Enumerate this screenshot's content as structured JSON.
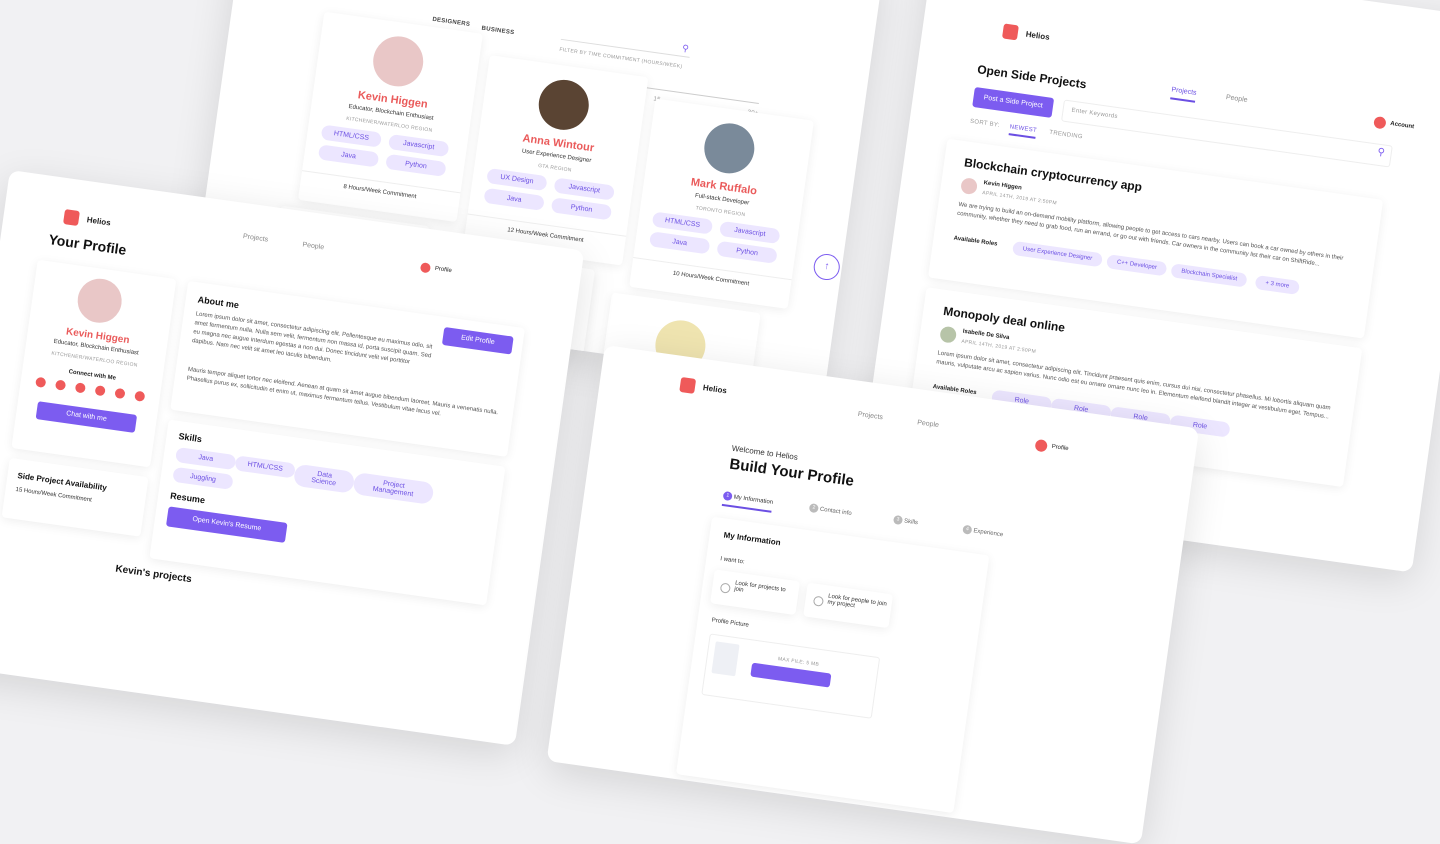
{
  "brand": {
    "name": "Helios"
  },
  "talent": {
    "filters": {
      "tab_designers": "DESIGNERS",
      "tab_business": "BUSINESS",
      "label": "FILTER BY TIME COMMITMENT (HOURS/WEEK)",
      "tick_0": "0",
      "tick_15": "15",
      "tick_30": "30+"
    },
    "people": [
      {
        "name": "Kevin Higgen",
        "title": "Educator, Blockchain Enthusiast",
        "region": "KITCHENER/WATERLOO REGION",
        "skills": [
          "HTML/CSS",
          "Javascript",
          "Java",
          "Python"
        ],
        "commitment": "8 Hours/Week Commitment"
      },
      {
        "name": "Anna Wintour",
        "title": "User Experience Designer",
        "region": "GTA REGION",
        "skills": [
          "UX Design",
          "Javascript",
          "Java",
          "Python"
        ],
        "commitment": "12 Hours/Week Commitment"
      },
      {
        "name": "Mark Ruffalo",
        "title": "Full-stack Developer",
        "region": "TORONTO REGION",
        "skills": [
          "HTML/CSS",
          "Javascript",
          "Java",
          "Python"
        ],
        "commitment": "10 Hours/Week Commitment"
      }
    ]
  },
  "projects_page": {
    "title": "Open Side Projects",
    "nav": {
      "projects": "Projects",
      "people": "People",
      "account": "Account"
    },
    "post_button": "Post a Side Project",
    "search_placeholder": "Enter Keywords",
    "sort_label": "SORT BY:",
    "sort_newest": "NEWEST",
    "sort_trending": "TRENDING",
    "projects": [
      {
        "title": "Blockchain cryptocurrency app",
        "author": "Kevin Higgen",
        "date": "APRIL 14TH, 2019 AT 2:50PM",
        "desc": "We are trying to build an on-demand mobility platform, allowing people to get access to cars nearby. Users can book a car owned by others in their community, whether they need to grab food, run an errand, or go out with friends. Car owners in the community list their car on ShiftRide...",
        "roles_label": "Available Roles",
        "roles": [
          "User Experience Designer",
          "C++ Developer",
          "Blockchain Specialist",
          "+ 3 more"
        ]
      },
      {
        "title": "Monopoly deal online",
        "author": "Isabelle De Silva",
        "date": "APRIL 14TH, 2019 AT 2:50PM",
        "desc": "Lorem ipsum dolor sit amet, consectetur adipiscing elit. Tincidunt praesent quis enim, cursus dui nisi, consectetur phasellus. Mi lobortis aliquam quam mauris, vulputate arcu ac sapien varius. Nunc odio est eu ornare ornare nunc leo in. Elementum eleifend blandit integer at vestibulum eget. Tempus...",
        "roles_label": "Available Roles",
        "roles": [
          "Role",
          "Role",
          "Role",
          "Role"
        ]
      }
    ]
  },
  "profile_page": {
    "title": "Your Profile",
    "nav": {
      "projects": "Projects",
      "people": "People",
      "profile": "Profile"
    },
    "name": "Kevin Higgen",
    "tagline": "Educator, Blockchain Enthusiast",
    "region": "KITCHENER/WATERLOO REGION",
    "connect": "Connect with Me",
    "chat_button": "Chat with me",
    "availability_title": "Side Project Availability",
    "availability_value": "15 Hours/Week Commitment",
    "about_title": "About me",
    "edit_button": "Edit Profile",
    "about_p1": "Lorem ipsum dolor sit amet, consectetur adipiscing elit. Pellentesque eu maximus odio, sit amet fermentum nulla. Nulla sem velit, fermentum non massa id, porta suscipit quam. Sed eu magna nec augue interdum egestas a non dui. Donec tincidunt velit vel porttitor dapibus. Nam nec velit sit amet leo iaculis bibendum.",
    "about_p2": "Mauris tempor aliquet tortor nec eleifend. Aenean at quam sit amet augue bibendum laoreet. Mauris a venenatis nulla. Phasellus purus ex, sollicitudin et enim ut, maximus fermentum tellus. Vestibulum vitae lacus vel.",
    "skills_title": "Skills",
    "skills": [
      "Java",
      "HTML/CSS",
      "Data Science",
      "Project Management",
      "Juggling"
    ],
    "resume_title": "Resume",
    "resume_button": "Open Kevin's Resume",
    "projects_title": "Kevin's projects"
  },
  "build_page": {
    "nav": {
      "projects": "Projects",
      "people": "People",
      "profile": "Profile"
    },
    "welcome": "Welcome to Helios",
    "title": "Build Your Profile",
    "steps": [
      {
        "num": "1",
        "label": "My Information"
      },
      {
        "num": "2",
        "label": "Contact info"
      },
      {
        "num": "3",
        "label": "Skills"
      },
      {
        "num": "4",
        "label": "Experience"
      }
    ],
    "section_title": "My Information",
    "i_want_to": "I want to:",
    "option_1": "Look for projects to join",
    "option_2": "Look for people to join my project",
    "picture_label": "Profile Picture",
    "max_file": "MAX FILE: 5 MB"
  }
}
